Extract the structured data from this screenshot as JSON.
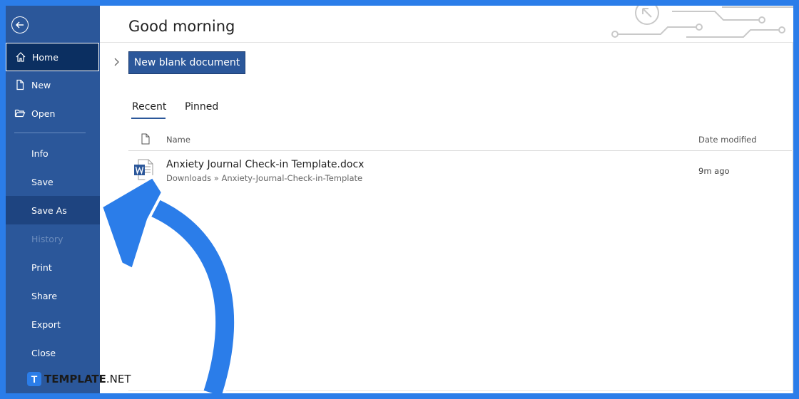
{
  "sidebar": {
    "back_icon": "back-arrow-icon",
    "items": [
      {
        "label": "Home",
        "icon": "home-icon",
        "state": "selected"
      },
      {
        "label": "New",
        "icon": "new-document-icon"
      },
      {
        "label": "Open",
        "icon": "open-folder-icon"
      },
      {
        "label": "Info"
      },
      {
        "label": "Save"
      },
      {
        "label": "Save As",
        "state": "highlighted"
      },
      {
        "label": "History",
        "state": "disabled"
      },
      {
        "label": "Print"
      },
      {
        "label": "Share"
      },
      {
        "label": "Export"
      },
      {
        "label": "Close"
      }
    ]
  },
  "main": {
    "greeting": "Good morning",
    "new_blank_label": "New blank document",
    "tabs": [
      {
        "label": "Recent",
        "active": true
      },
      {
        "label": "Pinned",
        "active": false
      }
    ],
    "columns": {
      "name": "Name",
      "date": "Date modified"
    },
    "files": [
      {
        "name": "Anxiety Journal Check-in Template.docx",
        "path": "Downloads » Anxiety-Journal-Check-in-Template",
        "modified": "9m ago",
        "icon": "word-document-icon"
      }
    ]
  },
  "watermark": {
    "brand": "TEMPLATE",
    "suffix": ".NET"
  },
  "colors": {
    "sidebar": "#2b579a",
    "selected": "#0b2f61",
    "accent": "#2b7de9",
    "button": "#2b579a"
  }
}
